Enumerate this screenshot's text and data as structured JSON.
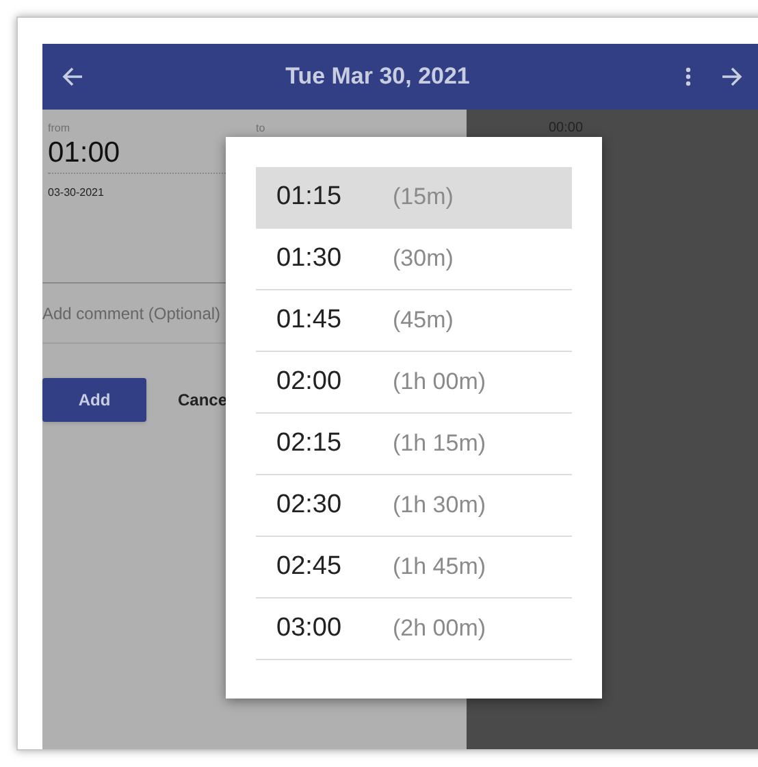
{
  "app_bar": {
    "title": "Tue Mar 30, 2021"
  },
  "form": {
    "from_label": "from",
    "from_time": "01:00",
    "to_label": "to",
    "date": "03-30-2021",
    "comment_placeholder": "Add comment (Optional)",
    "add_button": "Add",
    "cancel_button": "Cance"
  },
  "timeline": {
    "first_label": "00:00"
  },
  "time_menu": [
    {
      "time": "01:15",
      "duration": "(15m)",
      "selected": true
    },
    {
      "time": "01:30",
      "duration": "(30m)",
      "selected": false
    },
    {
      "time": "01:45",
      "duration": "(45m)",
      "selected": false
    },
    {
      "time": "02:00",
      "duration": "(1h 00m)",
      "selected": false
    },
    {
      "time": "02:15",
      "duration": "(1h 15m)",
      "selected": false
    },
    {
      "time": "02:30",
      "duration": "(1h 30m)",
      "selected": false
    },
    {
      "time": "02:45",
      "duration": "(1h 45m)",
      "selected": false
    },
    {
      "time": "03:00",
      "duration": "(2h 00m)",
      "selected": false
    }
  ]
}
